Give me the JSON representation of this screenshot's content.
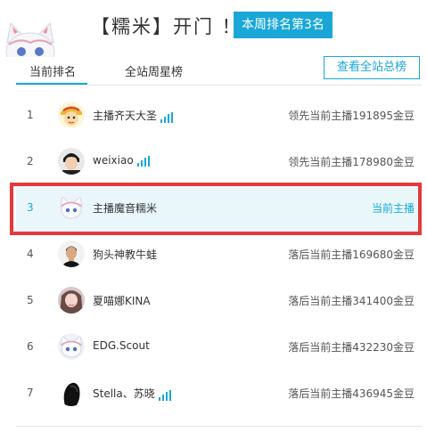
{
  "header": {
    "title": "【糯米】开门 ！",
    "rank_badge": "本周排名第3名"
  },
  "tabs": {
    "current": "当前排名",
    "week": "全站周星榜",
    "view_all": "查看全站总榜"
  },
  "rows": [
    {
      "rank": "1",
      "name": "主播齐天大圣",
      "signal": true,
      "status": "领先当前主播191895金豆",
      "avatar_icon": "monkey-king-avatar-icon"
    },
    {
      "rank": "2",
      "name": "weixiao",
      "signal": true,
      "status": "领先当前主播178980金豆",
      "avatar_icon": "boy-avatar-icon"
    },
    {
      "rank": "3",
      "name": "主播魔音糯米",
      "signal": false,
      "status": "当前主播",
      "avatar_icon": "cat-mascot-avatar-icon",
      "current": true
    },
    {
      "rank": "4",
      "name": "狗头神教牛蛙",
      "signal": false,
      "status": "落后当前主播169680金豆",
      "avatar_icon": "man-avatar-icon"
    },
    {
      "rank": "5",
      "name": "夏喵娜KINA",
      "signal": false,
      "status": "落后当前主播341400金豆",
      "avatar_icon": "girl-avatar-icon"
    },
    {
      "rank": "6",
      "name": "EDG.Scout",
      "signal": false,
      "status": "落后当前主播432230金豆",
      "avatar_icon": "cat-mascot-avatar-icon"
    },
    {
      "rank": "7",
      "name": "Stella、苏晓",
      "signal": true,
      "status": "落后当前主播436945金豆",
      "avatar_icon": "silhouette-avatar-icon"
    }
  ],
  "colors": {
    "accent": "#1aa7d8",
    "highlight_border": "#e4393c",
    "current_row_bg": "#e9f7fb"
  }
}
